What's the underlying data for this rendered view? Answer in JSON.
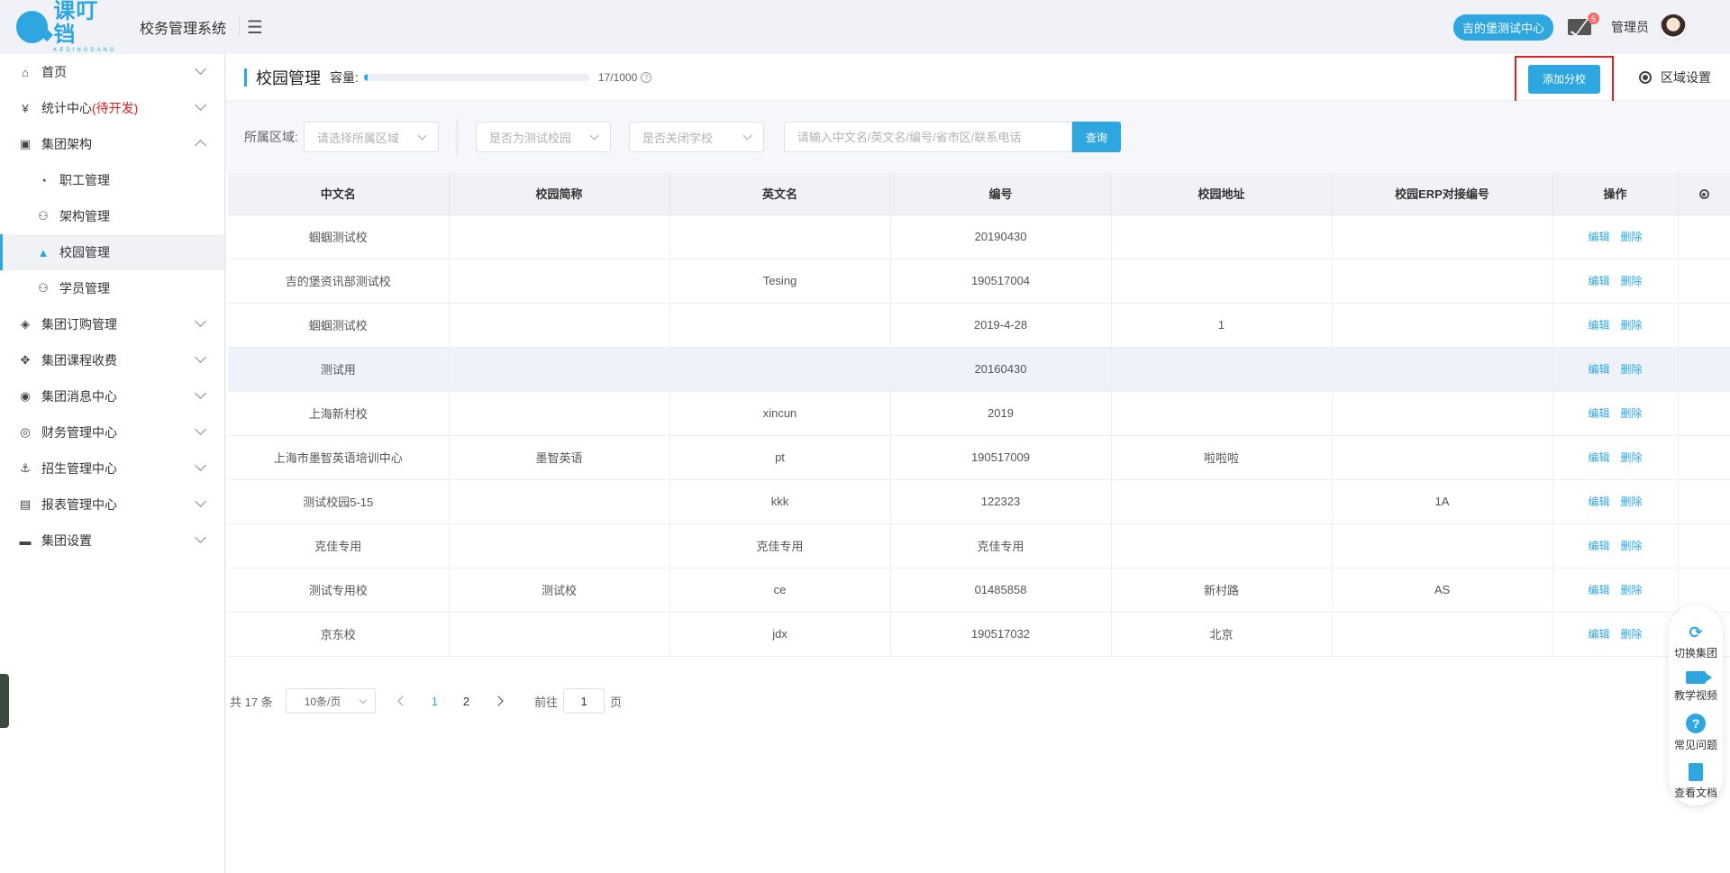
{
  "header": {
    "logo_text": "课叮铛",
    "logo_sub": "KEDINGDANG",
    "system_title": "校务管理系统",
    "menu_toggle": "☰",
    "center_name": "吉的堡测试中心",
    "mail_count": "5",
    "user_role": "管理员"
  },
  "sidebar": {
    "items": [
      {
        "label": "首页",
        "icon": "⌂"
      },
      {
        "label": "统计中心",
        "tag": "(待开发)",
        "icon": "¥"
      },
      {
        "label": "集团架构",
        "icon": "▣"
      },
      {
        "label": "职工管理",
        "icon": "◔"
      },
      {
        "label": "架构管理",
        "icon": "⚇"
      },
      {
        "label": "校园管理",
        "icon": "▲"
      },
      {
        "label": "学员管理",
        "icon": "⚇"
      },
      {
        "label": "集团订购管理",
        "icon": "◈"
      },
      {
        "label": "集团课程收费",
        "icon": "✥"
      },
      {
        "label": "集团消息中心",
        "icon": "◉"
      },
      {
        "label": "财务管理中心",
        "icon": "◎"
      },
      {
        "label": "招生管理中心",
        "icon": "⚓"
      },
      {
        "label": "报表管理中心",
        "icon": "▤"
      },
      {
        "label": "集团设置",
        "icon": "▬"
      }
    ]
  },
  "page": {
    "title": "校园管理",
    "capacity_label": "容量:",
    "capacity_count": "17/1000",
    "capacity_fraction": 0.017,
    "add_button": "添加分校",
    "region_settings": "区域设置"
  },
  "filters": {
    "region_label": "所属区域:",
    "region_placeholder": "请选择所属区域",
    "test_campus_placeholder": "是否为测试校园",
    "closed_school_placeholder": "是否关闭学校",
    "search_placeholder": "请输入中文名/英文名/编号/省市区/联系电话",
    "search_button": "查询"
  },
  "table": {
    "headers": [
      "中文名",
      "校园简称",
      "英文名",
      "编号",
      "校园地址",
      "校园ERP对接编号",
      "操作"
    ],
    "edit_label": "编辑",
    "delete_label": "删除",
    "rows": [
      [
        "蝈蝈测试校",
        "",
        "",
        "20190430",
        "",
        ""
      ],
      [
        "吉的堡资讯部测试校",
        "",
        "Tesing",
        "190517004",
        "",
        ""
      ],
      [
        "蝈蝈测试校",
        "",
        "",
        "2019-4-28",
        "1",
        ""
      ],
      [
        "测试用",
        "",
        "",
        "20160430",
        "",
        ""
      ],
      [
        "上海新村校",
        "",
        "xincun",
        "2019",
        "",
        ""
      ],
      [
        "上海市墨智英语培训中心",
        "墨智英语",
        "pt",
        "190517009",
        "啦啦啦",
        ""
      ],
      [
        "测试校园5-15",
        "",
        "kkk",
        "122323",
        "",
        "1A"
      ],
      [
        "克佳专用",
        "",
        "克佳专用",
        "克佳专用",
        "",
        ""
      ],
      [
        "测试专用校",
        "测试校",
        "ce",
        "01485858",
        "新村路",
        "AS"
      ],
      [
        "京东校",
        "",
        "jdx",
        "190517032",
        "北京",
        ""
      ]
    ]
  },
  "pagination": {
    "total": "共 17 条",
    "page_size": "10条/页",
    "pages": [
      "1",
      "2"
    ],
    "goto_label": "前往",
    "current_page": "1",
    "page_suffix": "页"
  },
  "float_tools": [
    {
      "label": "切换集团",
      "icon": "⟳"
    },
    {
      "label": "教学视频",
      "icon": ""
    },
    {
      "label": "常见问题",
      "icon": "?"
    },
    {
      "label": "查看文档",
      "icon": ""
    }
  ]
}
